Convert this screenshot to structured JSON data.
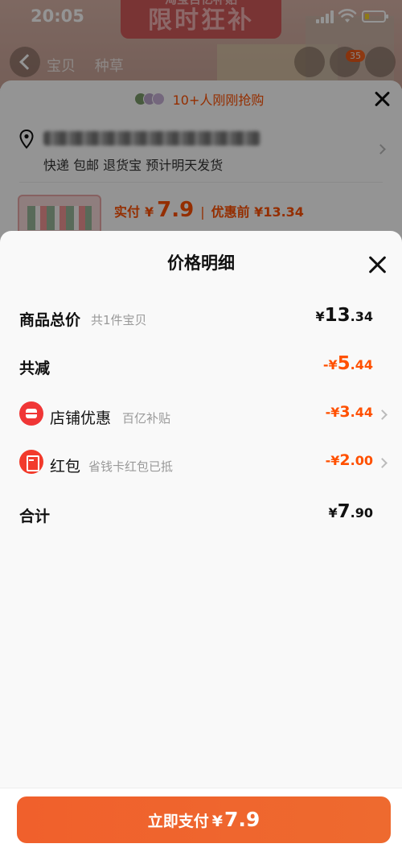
{
  "status_bar": {
    "time": "20:05"
  },
  "background": {
    "hero_banner_sub": "淘宝百亿补贴",
    "hero_banner_main": "限时狂补",
    "nav_tabs": [
      "宝贝",
      "种草"
    ],
    "cart_count": "35"
  },
  "order_sheet": {
    "rush_text": "10+人刚刚抢购",
    "delivery": "快递 包邮 退货宝 预计明天发货",
    "pay_label": "实付",
    "pay_currency": "¥",
    "pay_amount": "7.9",
    "pay_separator": "|",
    "price_before": "优惠前 ¥13.34"
  },
  "price_detail": {
    "title": "价格明细",
    "rows": [
      {
        "label": "商品总价",
        "sub": "共1件宝贝",
        "value_prefix": "¥",
        "value_int": "13",
        "value_dec": ".34",
        "color": "#111111",
        "chevron": false
      },
      {
        "label": "共减",
        "sub": "",
        "value_prefix": "-¥",
        "value_int": "5",
        "value_dec": ".44",
        "color": "#ff5000",
        "chevron": false
      },
      {
        "label": "店铺优惠",
        "sub": "百亿补贴",
        "value_prefix": "-¥",
        "value_int": "3",
        "value_dec": ".44",
        "color": "#ff5000",
        "chevron": true,
        "icon": "shop-icon"
      },
      {
        "label": "红包",
        "sub": "省钱卡红包已抵",
        "value_prefix": "-¥",
        "value_int": "2",
        "value_dec": ".00",
        "color": "#ff5000",
        "chevron": true,
        "icon": "red-envelope-icon"
      },
      {
        "label": "合计",
        "sub": "",
        "value_prefix": "¥",
        "value_int": "7",
        "value_dec": ".90",
        "color": "#111111",
        "chevron": false
      }
    ]
  },
  "pay_button": {
    "label": "立即支付",
    "currency": "¥",
    "amount": "7.9"
  },
  "colors": {
    "accent": "#ff5000",
    "button": "#ee6a2f"
  }
}
